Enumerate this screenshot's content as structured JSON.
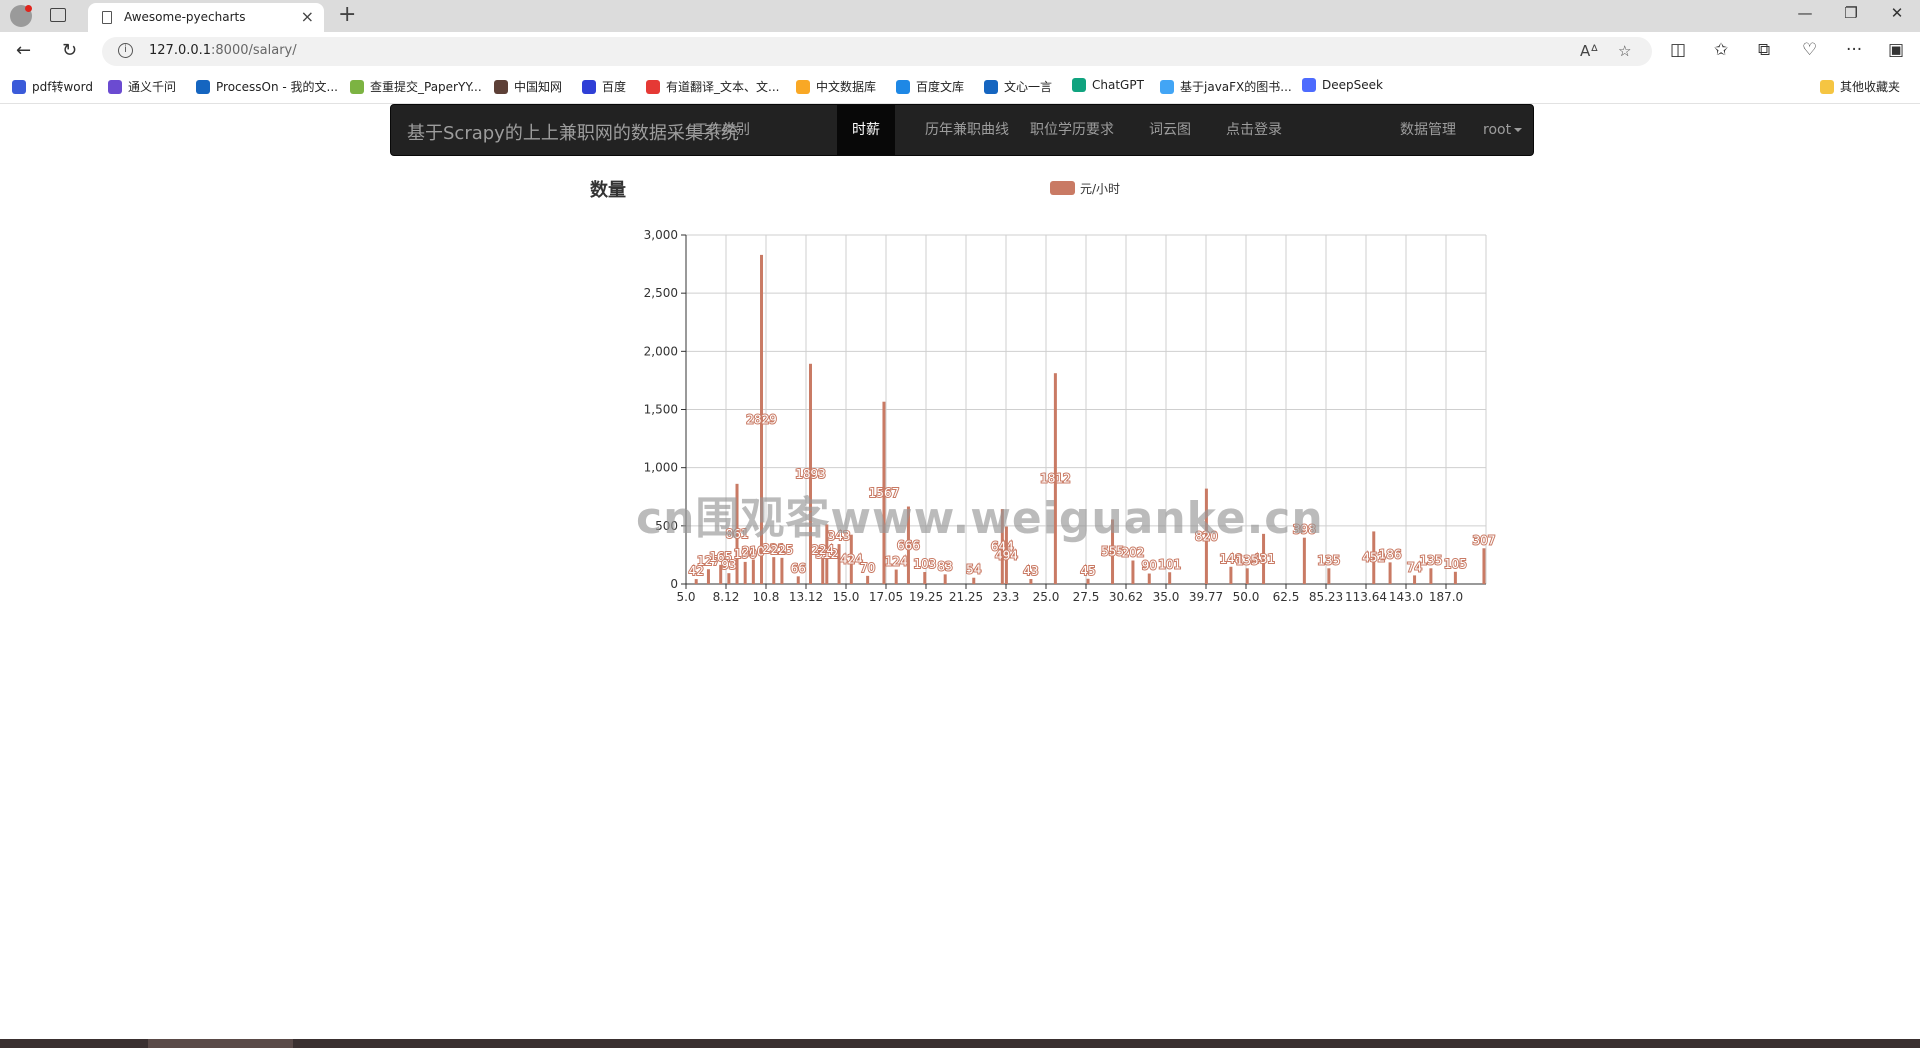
{
  "browser": {
    "tab_title": "Awesome-pyecharts",
    "url_host": "127.0.0.1",
    "url_rest": ":8000/salary/",
    "bookmarks": [
      {
        "label": "pdf转word",
        "color": "#3b5bd9"
      },
      {
        "label": "通义千问",
        "color": "#6b4bd1"
      },
      {
        "label": "ProcessOn - 我的文...",
        "color": "#1565c0"
      },
      {
        "label": "查重提交_PaperYY...",
        "color": "#7cb342"
      },
      {
        "label": "中国知网",
        "color": "#5d4037"
      },
      {
        "label": "百度",
        "color": "#2f3fd6"
      },
      {
        "label": "有道翻译_文本、文...",
        "color": "#e53935"
      },
      {
        "label": "中文数据库",
        "color": "#f9a825"
      },
      {
        "label": "百度文库",
        "color": "#1e88e5"
      },
      {
        "label": "文心一言",
        "color": "#1565c0"
      },
      {
        "label": "ChatGPT",
        "color": "#10a37f"
      },
      {
        "label": "基于javaFX的图书...",
        "color": "#42a5f5"
      },
      {
        "label": "DeepSeek",
        "color": "#4d6bfe"
      }
    ],
    "other_bookmarks": "其他收藏夹"
  },
  "navbar": {
    "brand": "基于Scrapy的上上兼职网的数据采集系统",
    "links": [
      {
        "label": "工作类别",
        "active": false
      },
      {
        "label": "时薪",
        "active": true
      },
      {
        "label": "历年兼职曲线",
        "active": false
      },
      {
        "label": "职位学历要求",
        "active": false
      },
      {
        "label": "词云图",
        "active": false
      },
      {
        "label": "点击登录",
        "active": false
      }
    ],
    "right": {
      "data_manage": "数据管理",
      "user": "root"
    }
  },
  "watermark": "cn围观客www.weiguanke.cn",
  "chart_data": {
    "type": "bar",
    "title": "数量",
    "legend": "元/小时",
    "legend_position": "top-center",
    "color": "#c97a64",
    "ylim": [
      0,
      3000
    ],
    "yticks": [
      0,
      500,
      1000,
      1500,
      2000,
      2500,
      3000
    ],
    "ytick_labels": [
      "0",
      "500",
      "1,000",
      "1,500",
      "2,000",
      "2,500",
      "3,000"
    ],
    "xtick_labels": [
      "5.0",
      "8.12",
      "10.8",
      "13.12",
      "15.0",
      "17.05",
      "19.25",
      "21.25",
      "23.3",
      "25.0",
      "27.5",
      "30.62",
      "35.0",
      "39.77",
      "50.0",
      "62.5",
      "85.23",
      "113.64",
      "143.0",
      "187.0"
    ],
    "grid": true,
    "categories_count": 196,
    "series": [
      {
        "name": "元/小时",
        "bars": [
          {
            "index": 12,
            "value": 861
          },
          {
            "index": 18,
            "value": 2829
          },
          {
            "index": 30,
            "value": 1893
          },
          {
            "index": 34,
            "value": 512
          },
          {
            "index": 48,
            "value": 1567
          },
          {
            "index": 54,
            "value": 666
          },
          {
            "index": 77,
            "value": 644
          },
          {
            "index": 78,
            "value": 494
          },
          {
            "index": 90,
            "value": 1812
          },
          {
            "index": 104,
            "value": 555
          },
          {
            "index": 127,
            "value": 820
          },
          {
            "index": 141,
            "value": 431
          },
          {
            "index": 151,
            "value": 398
          },
          {
            "index": 168,
            "value": 452
          },
          {
            "index": 195,
            "value": 307
          },
          {
            "index": 2,
            "value": 42
          },
          {
            "index": 5,
            "value": 127
          },
          {
            "index": 8,
            "value": 165
          },
          {
            "index": 10,
            "value": 93
          },
          {
            "index": 14,
            "value": 190
          },
          {
            "index": 16,
            "value": 210
          },
          {
            "index": 21,
            "value": 231
          },
          {
            "index": 23,
            "value": 225
          },
          {
            "index": 27,
            "value": 66
          },
          {
            "index": 33,
            "value": 224
          },
          {
            "index": 37,
            "value": 343
          },
          {
            "index": 40,
            "value": 424
          },
          {
            "index": 44,
            "value": 70
          },
          {
            "index": 51,
            "value": 124
          },
          {
            "index": 58,
            "value": 103
          },
          {
            "index": 63,
            "value": 83
          },
          {
            "index": 70,
            "value": 54
          },
          {
            "index": 84,
            "value": 43
          },
          {
            "index": 98,
            "value": 45
          },
          {
            "index": 109,
            "value": 202
          },
          {
            "index": 113,
            "value": 90
          },
          {
            "index": 118,
            "value": 101
          },
          {
            "index": 133,
            "value": 148
          },
          {
            "index": 137,
            "value": 135
          },
          {
            "index": 157,
            "value": 135
          },
          {
            "index": 172,
            "value": 186
          },
          {
            "index": 178,
            "value": 74
          },
          {
            "index": 182,
            "value": 135
          },
          {
            "index": 188,
            "value": 105
          }
        ]
      }
    ]
  }
}
